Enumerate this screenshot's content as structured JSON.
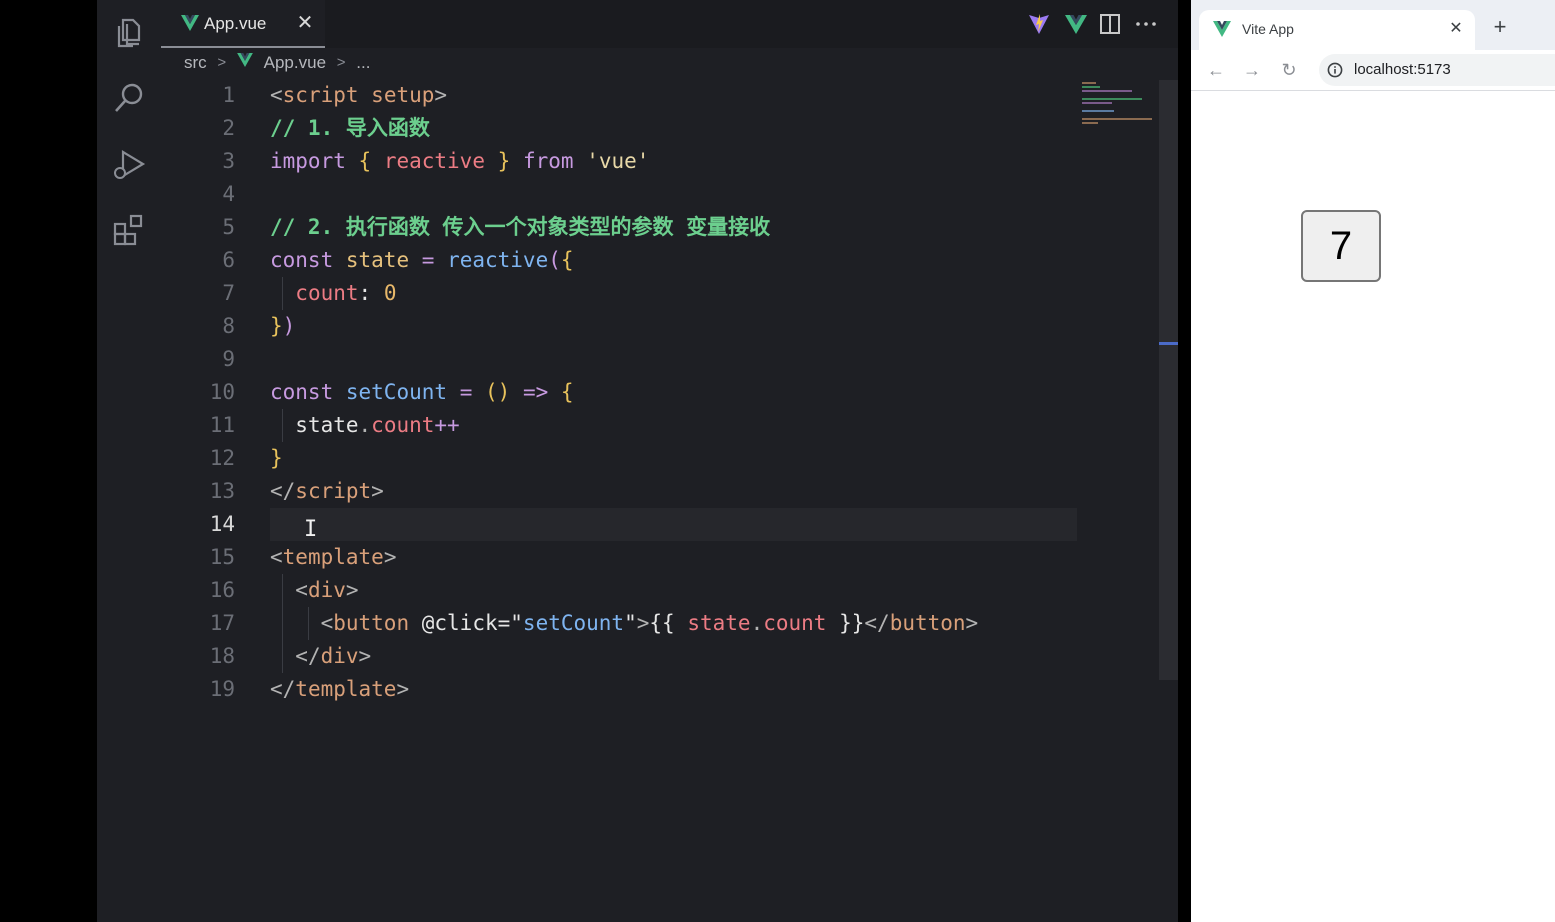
{
  "editor": {
    "tab": {
      "label": "App.vue"
    },
    "breadcrumb": [
      "src",
      "App.vue",
      "..."
    ],
    "active_line": 14,
    "lines": [
      {
        "n": "1",
        "tokens": [
          [
            "<",
            "t-punc"
          ],
          [
            "script",
            "t-tag"
          ],
          [
            " ",
            "t-plain"
          ],
          [
            "setup",
            "t-attr"
          ],
          [
            ">",
            "t-punc"
          ]
        ]
      },
      {
        "n": "2",
        "tokens": [
          [
            "// 1. 导入函数",
            "t-cmt"
          ]
        ]
      },
      {
        "n": "3",
        "tokens": [
          [
            "import",
            "t-kw"
          ],
          [
            " ",
            "t-plain"
          ],
          [
            "{",
            "t-br"
          ],
          [
            " ",
            "t-plain"
          ],
          [
            "reactive",
            "t-prop"
          ],
          [
            " ",
            "t-plain"
          ],
          [
            "}",
            "t-br"
          ],
          [
            " ",
            "t-plain"
          ],
          [
            "from",
            "t-kw"
          ],
          [
            " ",
            "t-plain"
          ],
          [
            "'vue'",
            "t-str"
          ]
        ]
      },
      {
        "n": "4",
        "tokens": []
      },
      {
        "n": "5",
        "tokens": [
          [
            "// 2. 执行函数 传入一个对象类型的参数 变量接收",
            "t-cmt"
          ]
        ]
      },
      {
        "n": "6",
        "tokens": [
          [
            "const",
            "t-kw"
          ],
          [
            " ",
            "t-plain"
          ],
          [
            "state",
            "t-var"
          ],
          [
            " ",
            "t-plain"
          ],
          [
            "=",
            "t-op"
          ],
          [
            " ",
            "t-plain"
          ],
          [
            "reactive",
            "t-fn"
          ],
          [
            "(",
            "t-br2"
          ],
          [
            "{",
            "t-br"
          ]
        ]
      },
      {
        "n": "7",
        "tokens": [
          [
            "  ",
            "t-plain"
          ],
          [
            "count",
            "t-prop"
          ],
          [
            ":",
            "t-plain"
          ],
          [
            " ",
            "t-plain"
          ],
          [
            "0",
            "t-num"
          ]
        ]
      },
      {
        "n": "8",
        "tokens": [
          [
            "}",
            "t-br"
          ],
          [
            ")",
            "t-br2"
          ]
        ]
      },
      {
        "n": "9",
        "tokens": []
      },
      {
        "n": "10",
        "tokens": [
          [
            "const",
            "t-kw"
          ],
          [
            " ",
            "t-plain"
          ],
          [
            "setCount",
            "t-fn"
          ],
          [
            " ",
            "t-plain"
          ],
          [
            "=",
            "t-op"
          ],
          [
            " ",
            "t-plain"
          ],
          [
            "()",
            "t-br"
          ],
          [
            " ",
            "t-plain"
          ],
          [
            "=>",
            "t-op"
          ],
          [
            " ",
            "t-plain"
          ],
          [
            "{",
            "t-br"
          ]
        ]
      },
      {
        "n": "11",
        "tokens": [
          [
            "  ",
            "t-plain"
          ],
          [
            "state",
            "t-plain"
          ],
          [
            ".",
            "t-punc"
          ],
          [
            "count",
            "t-prop"
          ],
          [
            "++",
            "t-op"
          ]
        ]
      },
      {
        "n": "12",
        "tokens": [
          [
            "}",
            "t-br"
          ]
        ]
      },
      {
        "n": "13",
        "tokens": [
          [
            "</",
            "t-punc"
          ],
          [
            "script",
            "t-tag"
          ],
          [
            ">",
            "t-punc"
          ]
        ]
      },
      {
        "n": "14",
        "tokens": []
      },
      {
        "n": "15",
        "tokens": [
          [
            "<",
            "t-punc"
          ],
          [
            "template",
            "t-tag"
          ],
          [
            ">",
            "t-punc"
          ]
        ]
      },
      {
        "n": "16",
        "tokens": [
          [
            "  ",
            "t-plain"
          ],
          [
            "<",
            "t-punc"
          ],
          [
            "div",
            "t-tag"
          ],
          [
            ">",
            "t-punc"
          ]
        ]
      },
      {
        "n": "17",
        "tokens": [
          [
            "    ",
            "t-plain"
          ],
          [
            "<",
            "t-punc"
          ],
          [
            "button",
            "t-tag"
          ],
          [
            " ",
            "t-plain"
          ],
          [
            "@click",
            "t-plain"
          ],
          [
            "=",
            "t-plain"
          ],
          [
            "\"",
            "t-plain"
          ],
          [
            "setCount",
            "t-fn"
          ],
          [
            "\"",
            "t-plain"
          ],
          [
            ">",
            "t-punc"
          ],
          [
            "{{",
            "t-plain"
          ],
          [
            " ",
            "t-plain"
          ],
          [
            "state",
            "t-prop"
          ],
          [
            ".",
            "t-punc"
          ],
          [
            "count",
            "t-prop"
          ],
          [
            " ",
            "t-plain"
          ],
          [
            "}}",
            "t-plain"
          ],
          [
            "</",
            "t-punc"
          ],
          [
            "button",
            "t-tag"
          ],
          [
            ">",
            "t-punc"
          ]
        ]
      },
      {
        "n": "18",
        "tokens": [
          [
            "  ",
            "t-plain"
          ],
          [
            "</",
            "t-punc"
          ],
          [
            "div",
            "t-tag"
          ],
          [
            ">",
            "t-punc"
          ]
        ]
      },
      {
        "n": "19",
        "tokens": [
          [
            "</",
            "t-punc"
          ],
          [
            "template",
            "t-tag"
          ],
          [
            ">",
            "t-punc"
          ]
        ]
      }
    ]
  },
  "browser": {
    "tab_title": "Vite App",
    "url": "localhost:5173",
    "count_button": "7"
  },
  "icons": {
    "activity": [
      "explorer-icon",
      "search-icon",
      "run-debug-icon",
      "extensions-icon"
    ],
    "toolbar": [
      "vite-icon",
      "vue-devtools-icon",
      "split-editor-icon",
      "more-actions-icon"
    ]
  },
  "colors": {
    "editor_bg": "#1e1f24",
    "vue_green": "#42b883",
    "active_line_bg": "#26272c"
  }
}
